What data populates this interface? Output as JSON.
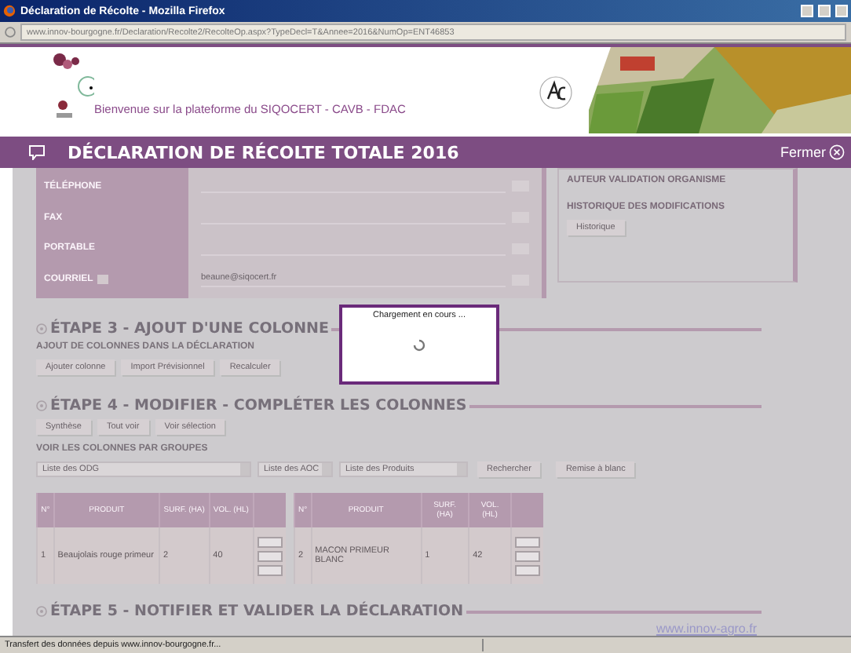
{
  "window": {
    "title": "Déclaration de Récolte - Mozilla Firefox",
    "url": "www.innov-bourgogne.fr/Declaration/Recolte2/RecolteOp.aspx?TypeDecl=T&Annee=2016&NumOp=ENT46853"
  },
  "header": {
    "welcome": "Bienvenue sur la plateforme du SIQOCERT - CAVB - FDAC"
  },
  "title_bar": {
    "title": "DÉCLARATION DE RÉCOLTE TOTALE 2016",
    "close": "Fermer"
  },
  "contact": {
    "fields": [
      {
        "label": "TÉLÉPHONE"
      },
      {
        "label": "FAX"
      },
      {
        "label": "PORTABLE"
      },
      {
        "label": "COURRIEL",
        "value": "beaune@siqocert.fr"
      }
    ]
  },
  "side_panel": {
    "items": [
      "AUTEUR VALIDATION ORGANISME",
      "HISTORIQUE DES MODIFICATIONS"
    ],
    "button": "Historique"
  },
  "step3": {
    "title": "ÉTAPE 3 - AJOUT D'UNE COLONNE",
    "subtitle": "AJOUT DE COLONNES DANS LA DÉCLARATION",
    "buttons": [
      "Ajouter colonne",
      "Import Prévisionnel",
      "Recalculer"
    ]
  },
  "step4": {
    "title": "ÉTAPE 4 - MODIFIER - COMPLÉTER LES COLONNES",
    "buttons": [
      "Synthèse",
      "Tout voir",
      "Voir sélection"
    ],
    "group_label": "VOIR LES COLONNES PAR GROUPES",
    "selects": [
      "Liste des ODG",
      "Liste des AOC",
      "Liste des Produits"
    ],
    "actions": [
      "Rechercher",
      "Remise à blanc"
    ]
  },
  "tables": [
    {
      "columns": [
        "N°",
        "PRODUIT",
        "SURF. (HA)",
        "VOL. (HL)"
      ],
      "row": [
        "1",
        "Beaujolais rouge primeur",
        "2",
        "40"
      ]
    },
    {
      "columns": [
        "N°",
        "PRODUIT",
        "SURF. (HA)",
        "VOL. (HL)"
      ],
      "row": [
        "2",
        "MACON PRIMEUR BLANC",
        "1",
        "42"
      ]
    }
  ],
  "step5": {
    "title": "ÉTAPE 5 - NOTIFIER ET VALIDER LA DÉCLARATION"
  },
  "footer_link": "www.innov-agro.fr",
  "modal": {
    "message": "Chargement en cours ..."
  },
  "status_bar": {
    "text": "Transfert des données depuis www.innov-bourgogne.fr..."
  }
}
